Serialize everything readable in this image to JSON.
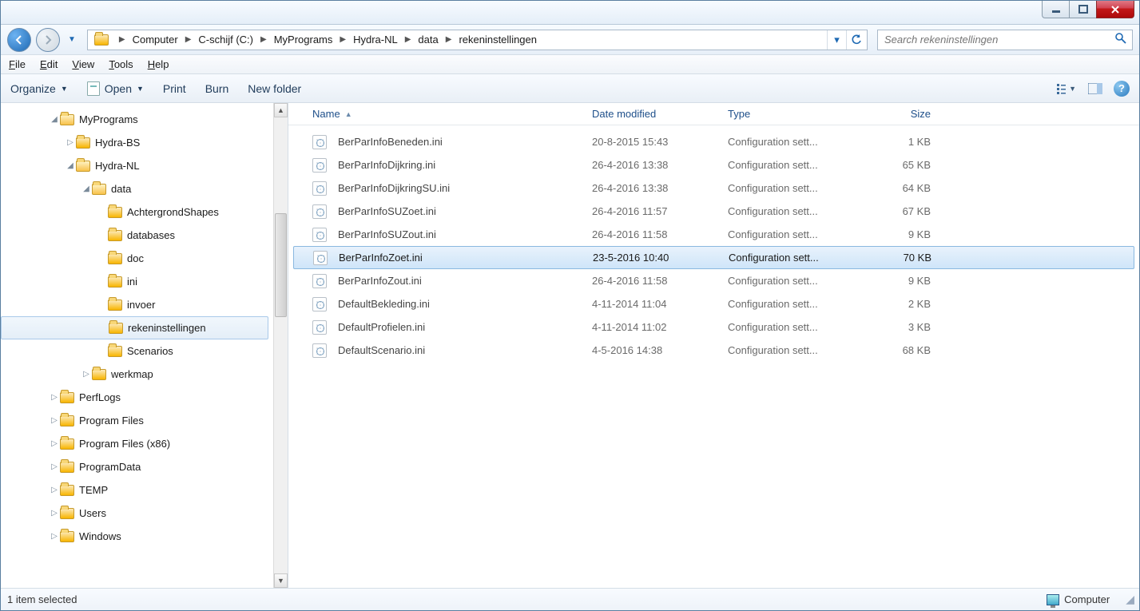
{
  "breadcrumb": [
    "Computer",
    "C-schijf (C:)",
    "MyPrograms",
    "Hydra-NL",
    "data",
    "rekeninstellingen"
  ],
  "search": {
    "placeholder": "Search rekeninstellingen"
  },
  "menubar": [
    {
      "u": "F",
      "rest": "ile"
    },
    {
      "u": "E",
      "rest": "dit"
    },
    {
      "u": "V",
      "rest": "iew"
    },
    {
      "u": "T",
      "rest": "ools"
    },
    {
      "u": "H",
      "rest": "elp"
    }
  ],
  "toolbar": {
    "organize": "Organize",
    "open": "Open",
    "print": "Print",
    "burn": "Burn",
    "newfolder": "New folder"
  },
  "tree": [
    {
      "indent": 60,
      "label": "MyPrograms",
      "open": true
    },
    {
      "indent": 80,
      "label": "Hydra-BS",
      "open": false
    },
    {
      "indent": 80,
      "label": "Hydra-NL",
      "open": true
    },
    {
      "indent": 100,
      "label": "data",
      "open": true
    },
    {
      "indent": 120,
      "label": "AchtergrondShapes",
      "open": false
    },
    {
      "indent": 120,
      "label": "databases",
      "open": false
    },
    {
      "indent": 120,
      "label": "doc",
      "open": false
    },
    {
      "indent": 120,
      "label": "ini",
      "open": false
    },
    {
      "indent": 120,
      "label": "invoer",
      "open": false
    },
    {
      "indent": 120,
      "label": "rekeninstellingen",
      "open": false,
      "selected": true
    },
    {
      "indent": 120,
      "label": "Scenarios",
      "open": false
    },
    {
      "indent": 100,
      "label": "werkmap",
      "open": false
    },
    {
      "indent": 60,
      "label": "PerfLogs",
      "open": false
    },
    {
      "indent": 60,
      "label": "Program Files",
      "open": false
    },
    {
      "indent": 60,
      "label": "Program Files (x86)",
      "open": false
    },
    {
      "indent": 60,
      "label": "ProgramData",
      "open": false
    },
    {
      "indent": 60,
      "label": "TEMP",
      "open": false
    },
    {
      "indent": 60,
      "label": "Users",
      "open": false
    },
    {
      "indent": 60,
      "label": "Windows",
      "open": false
    }
  ],
  "columns": {
    "name": "Name",
    "date": "Date modified",
    "type": "Type",
    "size": "Size"
  },
  "files": [
    {
      "name": "BerParInfoBeneden.ini",
      "date": "20-8-2015 15:43",
      "type": "Configuration sett...",
      "size": "1 KB"
    },
    {
      "name": "BerParInfoDijkring.ini",
      "date": "26-4-2016 13:38",
      "type": "Configuration sett...",
      "size": "65 KB"
    },
    {
      "name": "BerParInfoDijkringSU.ini",
      "date": "26-4-2016 13:38",
      "type": "Configuration sett...",
      "size": "64 KB"
    },
    {
      "name": "BerParInfoSUZoet.ini",
      "date": "26-4-2016 11:57",
      "type": "Configuration sett...",
      "size": "67 KB"
    },
    {
      "name": "BerParInfoSUZout.ini",
      "date": "26-4-2016 11:58",
      "type": "Configuration sett...",
      "size": "9 KB"
    },
    {
      "name": "BerParInfoZoet.ini",
      "date": "23-5-2016 10:40",
      "type": "Configuration sett...",
      "size": "70 KB",
      "selected": true
    },
    {
      "name": "BerParInfoZout.ini",
      "date": "26-4-2016 11:58",
      "type": "Configuration sett...",
      "size": "9 KB"
    },
    {
      "name": "DefaultBekleding.ini",
      "date": "4-11-2014 11:04",
      "type": "Configuration sett...",
      "size": "2 KB"
    },
    {
      "name": "DefaultProfielen.ini",
      "date": "4-11-2014 11:02",
      "type": "Configuration sett...",
      "size": "3 KB"
    },
    {
      "name": "DefaultScenario.ini",
      "date": "4-5-2016 14:38",
      "type": "Configuration sett...",
      "size": "68 KB"
    }
  ],
  "status": {
    "left": "1 item selected",
    "right": "Computer"
  }
}
